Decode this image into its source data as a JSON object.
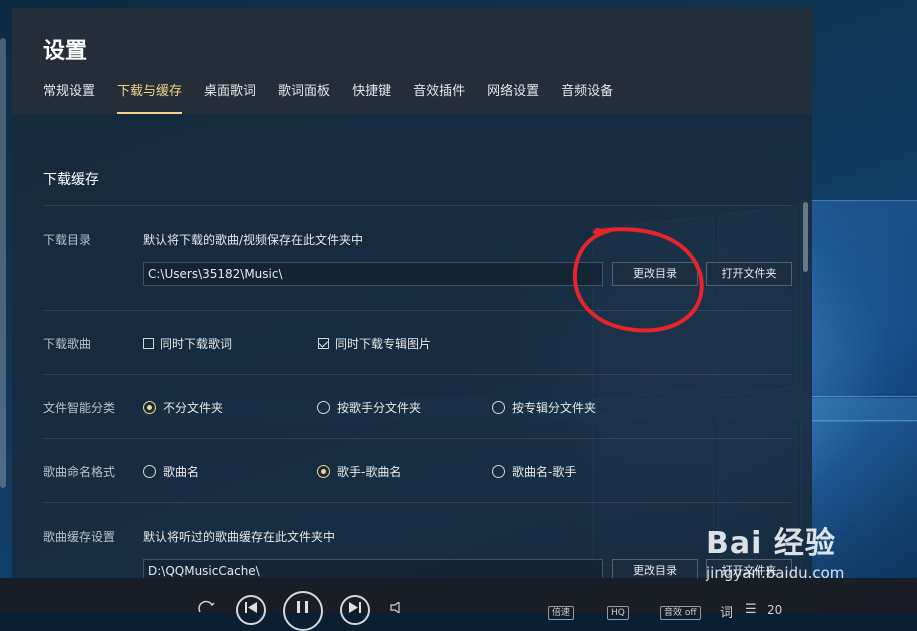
{
  "window": {
    "title": "设置"
  },
  "tabs": [
    "常规设置",
    "下载与缓存",
    "桌面歌词",
    "歌词面板",
    "快捷键",
    "音效插件",
    "网络设置",
    "音频设备"
  ],
  "active_tab_index": 1,
  "section": {
    "title": "下载缓存"
  },
  "download_dir": {
    "label": "下载目录",
    "description": "默认将下载的歌曲/视频保存在此文件夹中",
    "path": "C:\\Users\\35182\\Music\\",
    "change_btn": "更改目录",
    "open_btn": "打开文件夹"
  },
  "download_songs": {
    "label": "下载歌曲",
    "options": [
      {
        "label": "同时下载歌词",
        "checked": false
      },
      {
        "label": "同时下载专辑图片",
        "checked": true
      }
    ]
  },
  "smart_category": {
    "label": "文件智能分类",
    "options": [
      "不分文件夹",
      "按歌手分文件夹",
      "按专辑分文件夹"
    ],
    "selected_index": 0
  },
  "naming_format": {
    "label": "歌曲命名格式",
    "options": [
      "歌曲名",
      "歌手-歌曲名",
      "歌曲名-歌手"
    ],
    "selected_index": 1
  },
  "cache": {
    "label": "歌曲缓存设置",
    "description": "默认将听过的歌曲缓存在此文件夹中",
    "path": "D:\\QQMusicCache\\",
    "change_btn": "更改目录",
    "open_btn": "打开文件夹"
  },
  "player": {
    "speed_label": "倍速",
    "quality_label": "HQ",
    "effect_label": "音效 off",
    "lyrics_label": "词",
    "playlist_count": "20"
  },
  "watermark": {
    "logo": "Bai 经验",
    "site": "jingyan.baidu.com"
  },
  "colors": {
    "accent": "#f3d489",
    "annotation": "#e8242b"
  }
}
